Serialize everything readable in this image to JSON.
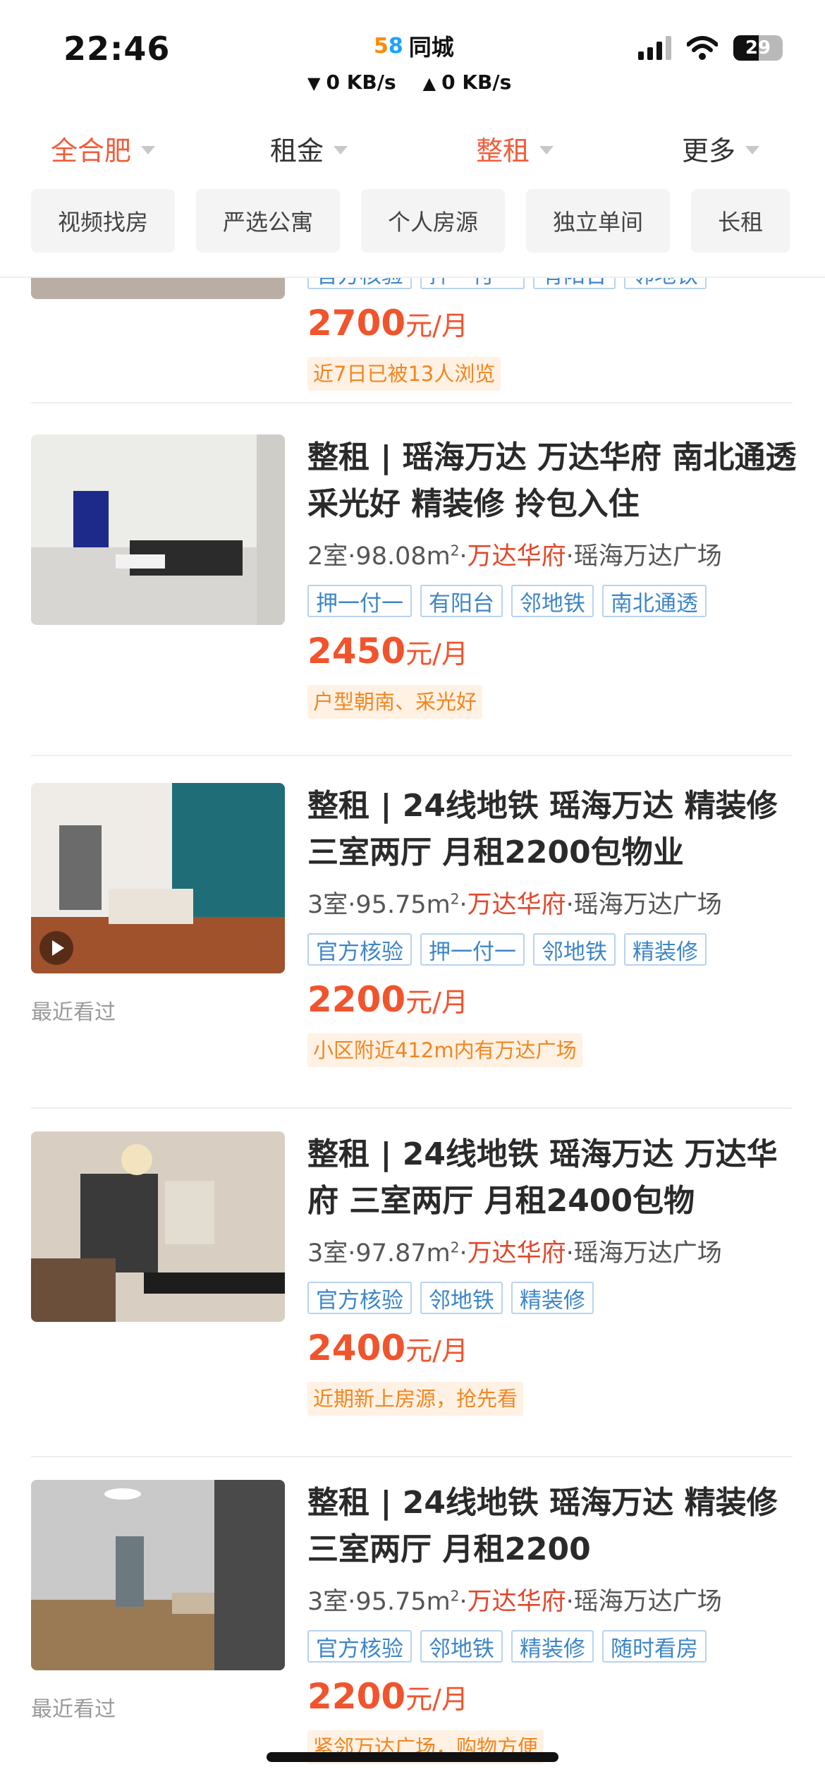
{
  "status_bar": {
    "time": "22:46",
    "app_logo": "58",
    "app_name": "同城",
    "download_arrow": "▼",
    "download_speed": "0 KB/s",
    "upload_arrow": "▲",
    "upload_speed": "0 KB/s",
    "battery_level": "29",
    "icons": [
      "signal-icon",
      "wifi-icon",
      "battery-icon"
    ]
  },
  "filters": {
    "area": "全合肥",
    "rent": "租金",
    "type": "整租",
    "more": "更多"
  },
  "chips": [
    "视频找房",
    "严选公寓",
    "个人房源",
    "独立单间",
    "长租"
  ],
  "listings": [
    {
      "partial": true,
      "tags": [
        "官方核验",
        "押一付一",
        "有阳台",
        "邻地铁"
      ],
      "price": "2700",
      "unit": "元/月",
      "hint": "近7日已被13人浏览"
    },
    {
      "title": "整租 | 瑶海万达 万达华府 南北通透 采光好 精装修 拎包入住",
      "rooms": "2室",
      "area": "98.08m",
      "area_sup": "2",
      "community": "万达华府",
      "district": "瑶海万达广场",
      "tags": [
        "押一付一",
        "有阳台",
        "邻地铁",
        "南北通透"
      ],
      "price": "2450",
      "unit": "元/月",
      "hint": "户型朝南、采光好",
      "has_video": false,
      "recent": ""
    },
    {
      "title": "整租 | 24线地铁 瑶海万达 精装修 三室两厅 月租2200包物业",
      "rooms": "3室",
      "area": "95.75m",
      "area_sup": "2",
      "community": "万达华府",
      "district": "瑶海万达广场",
      "tags": [
        "官方核验",
        "押一付一",
        "邻地铁",
        "精装修"
      ],
      "price": "2200",
      "unit": "元/月",
      "hint": "小区附近412m内有万达广场",
      "has_video": true,
      "recent": "最近看过"
    },
    {
      "title": "整租 | 24线地铁 瑶海万达 万达华府 三室两厅 月租2400包物",
      "rooms": "3室",
      "area": "97.87m",
      "area_sup": "2",
      "community": "万达华府",
      "district": "瑶海万达广场",
      "tags": [
        "官方核验",
        "邻地铁",
        "精装修"
      ],
      "price": "2400",
      "unit": "元/月",
      "hint": "近期新上房源，抢先看",
      "has_video": false,
      "recent": ""
    },
    {
      "title": "整租 | 24线地铁 瑶海万达 精装修 三室两厅 月租2200",
      "rooms": "3室",
      "area": "95.75m",
      "area_sup": "2",
      "community": "万达华府",
      "district": "瑶海万达广场",
      "tags": [
        "官方核验",
        "邻地铁",
        "精装修",
        "随时看房"
      ],
      "price": "2200",
      "unit": "元/月",
      "hint": "紧邻万达广场，购物方便",
      "has_video": false,
      "recent": "最近看过"
    }
  ],
  "colors": {
    "accent": "#f25c3a",
    "price": "#f1542d",
    "community": "#e2472b",
    "tag_text": "#3d86c9",
    "tag_border": "#b8d3ef",
    "hint_bg": "#fff1e4",
    "hint_text": "#f2861f"
  }
}
